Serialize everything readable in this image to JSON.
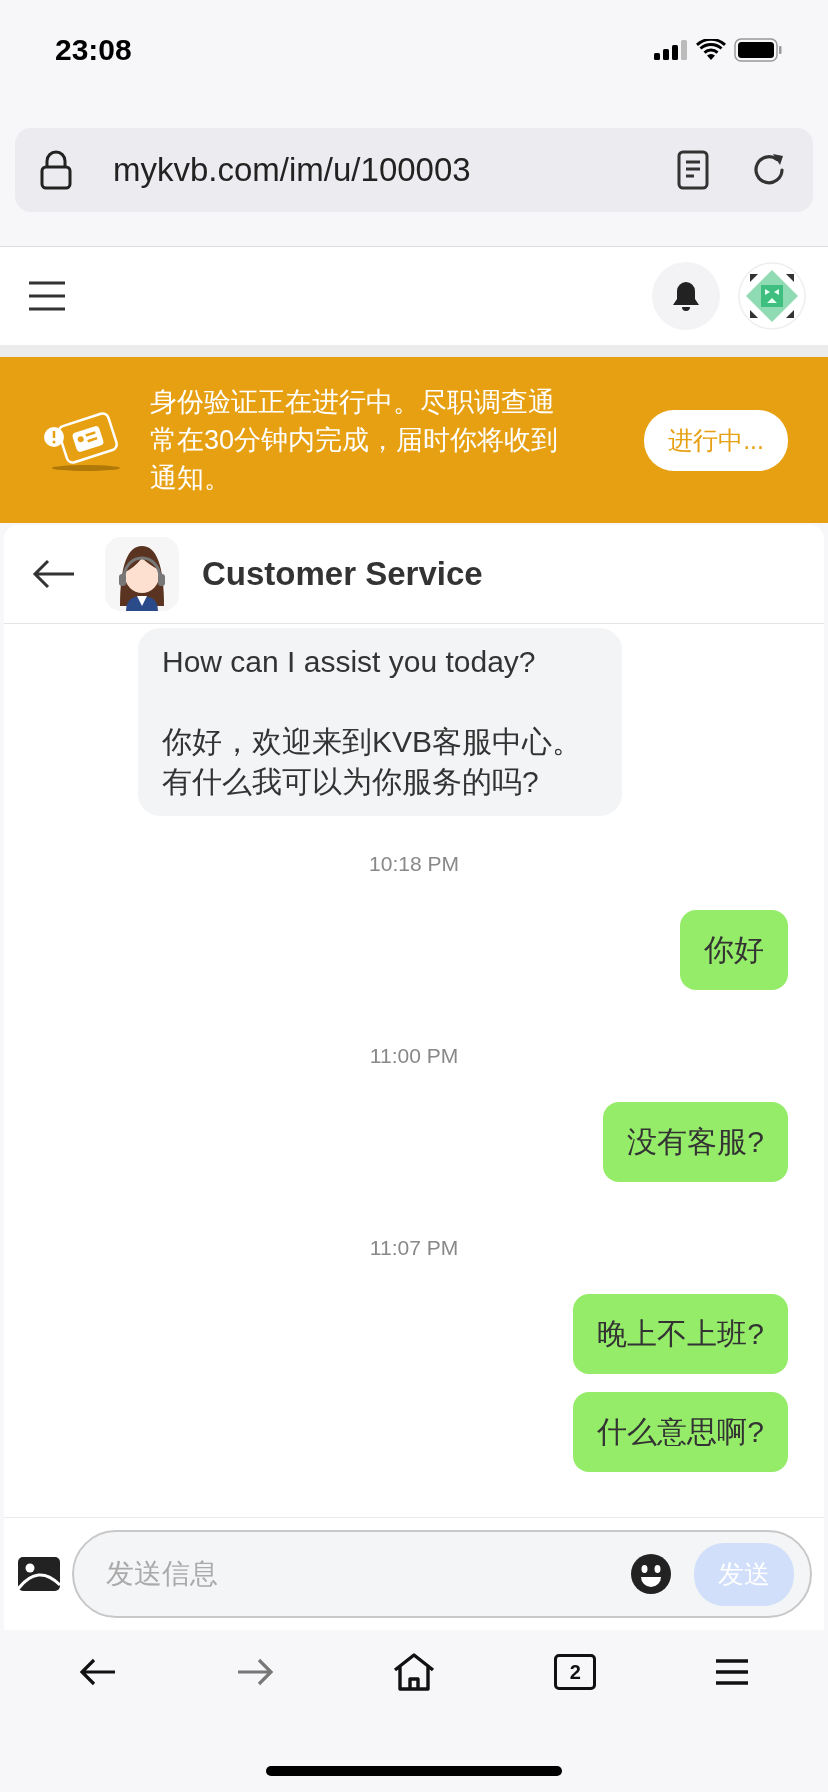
{
  "status_bar": {
    "time": "23:08"
  },
  "browser": {
    "url": "mykvb.com/im/u/100003"
  },
  "banner": {
    "message": "身份验证正在进行中。尽职调查通常在30分钟内完成，届时你将收到通知。",
    "button": "进行中..."
  },
  "chat": {
    "title": "Customer Service",
    "messages": [
      {
        "kind": "incoming",
        "text": "How can I assist you today?\n\n你好，欢迎来到KVB客服中心。有什么我可以为你服务的吗?"
      },
      {
        "kind": "time",
        "text": "10:18 PM"
      },
      {
        "kind": "outgoing",
        "text": "你好"
      },
      {
        "kind": "time",
        "text": "11:00 PM"
      },
      {
        "kind": "outgoing",
        "text": "没有客服?"
      },
      {
        "kind": "time",
        "text": "11:07 PM"
      },
      {
        "kind": "outgoing",
        "text": "晚上不上班?"
      },
      {
        "kind": "outgoing",
        "text": "什么意思啊?"
      }
    ]
  },
  "composer": {
    "placeholder": "发送信息",
    "send": "发送",
    "send_disabled": true
  },
  "bottom_bar": {
    "buttons": [
      {
        "kind": "back",
        "disabled": false
      },
      {
        "kind": "forward",
        "disabled": true
      },
      {
        "kind": "home",
        "disabled": false
      },
      {
        "kind": "tabs",
        "label": "2",
        "disabled": false
      },
      {
        "kind": "menu",
        "disabled": false
      }
    ]
  }
}
